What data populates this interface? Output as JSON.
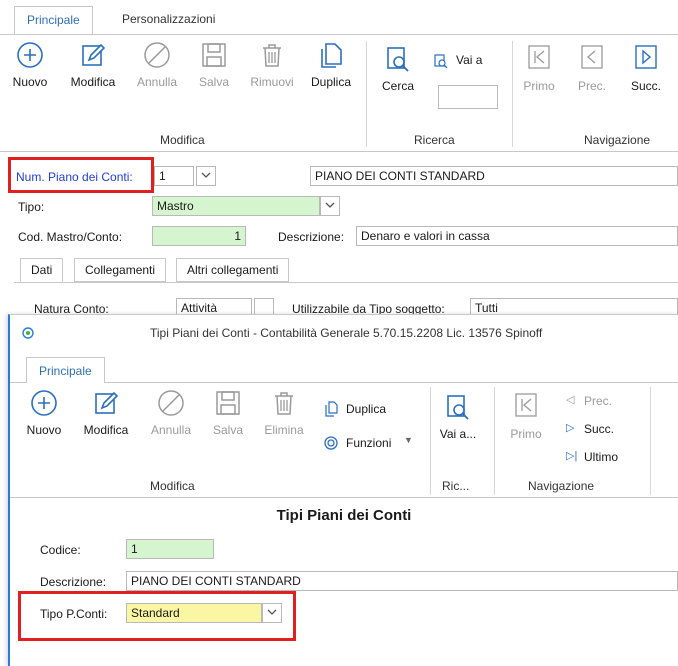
{
  "main": {
    "tabs": [
      "Principale",
      "Personalizzazioni"
    ],
    "ribbon": {
      "buttons": {
        "nuovo": "Nuovo",
        "modifica": "Modifica",
        "annulla": "Annulla",
        "salva": "Salva",
        "rimuovi": "Rimuovi",
        "duplica": "Duplica",
        "cerca": "Cerca",
        "vai_a": "Vai a",
        "primo": "Primo",
        "prec": "Prec.",
        "succ": "Succ."
      },
      "groups": {
        "modifica": "Modifica",
        "ricerca": "Ricerca",
        "navigazione": "Navigazione"
      }
    },
    "form": {
      "num_piano_label": "Num. Piano dei Conti:",
      "num_piano_value": "1",
      "piano_desc_value": "PIANO DEI CONTI STANDARD",
      "tipo_label": "Tipo:",
      "tipo_value": "Mastro",
      "cod_label": "Cod. Mastro/Conto:",
      "cod_value": "1",
      "descrizione_label": "Descrizione:",
      "descrizione_value": "Denaro e valori in cassa"
    },
    "subtabs": [
      "Dati",
      "Collegamenti",
      "Altri collegamenti"
    ],
    "natura_label": "Natura Conto:",
    "natura_value": "Attività",
    "utilizzabile_label": "Utilizzabile da Tipo soggetto:",
    "utilizzabile_value": "Tutti"
  },
  "dialog": {
    "title": "Tipi Piani dei Conti - Contabilità Generale 5.70.15.2208 Lic. 13576 Spinoff",
    "tab": "Principale",
    "buttons": {
      "nuovo": "Nuovo",
      "modifica": "Modifica",
      "annulla": "Annulla",
      "salva": "Salva",
      "elimina": "Elimina",
      "duplica": "Duplica",
      "funzioni": "Funzioni",
      "vai_a": "Vai a...",
      "primo": "Primo",
      "prec": "Prec.",
      "succ": "Succ.",
      "ultimo": "Ultimo"
    },
    "groups": {
      "modifica": "Modifica",
      "ricerca": "Ric...",
      "navigazione": "Navigazione"
    },
    "heading": "Tipi Piani dei Conti",
    "codice_label": "Codice:",
    "codice_value": "1",
    "descrizione_label": "Descrizione:",
    "descrizione_value": "PIANO DEI CONTI STANDARD",
    "tipo_label": "Tipo P.Conti:",
    "tipo_value": "Standard"
  },
  "colors": {
    "accent": "#2f6fb5",
    "icon_blue": "#2a6fc0",
    "highlight_red": "#e02020",
    "field_green": "#d5f5cf",
    "field_yellow": "#fbf6a4"
  }
}
